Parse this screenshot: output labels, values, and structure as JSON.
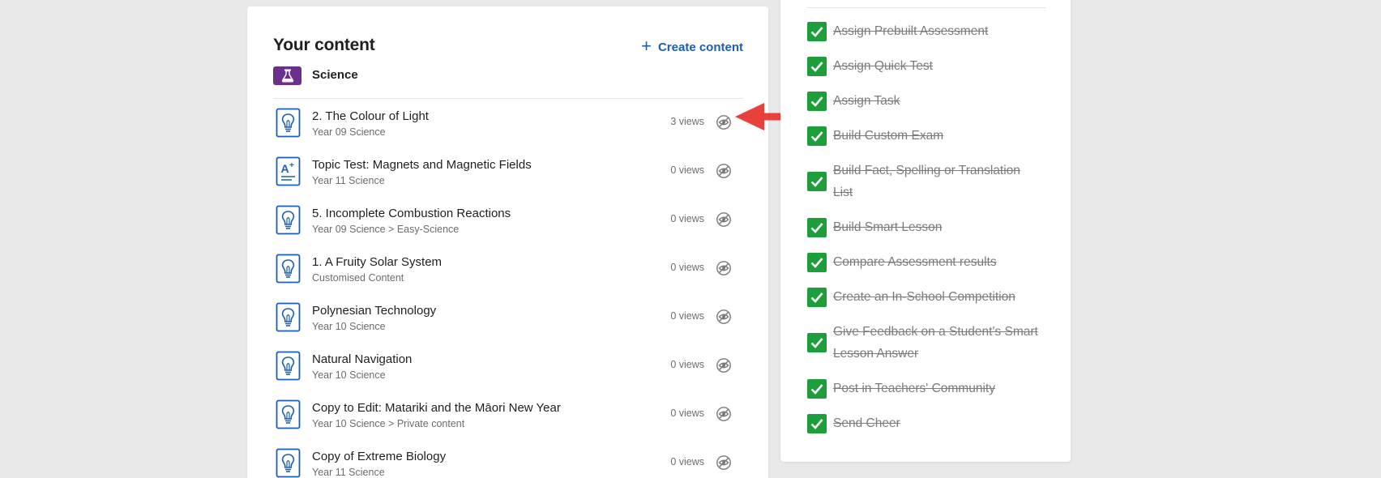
{
  "content_panel": {
    "title": "Your content",
    "create_label": "Create content",
    "subject": "Science",
    "items": [
      {
        "title": "2. The Colour of Light",
        "subtitle": "Year 09 Science",
        "views": "3 views",
        "icon": "lightbulb-icon"
      },
      {
        "title": "Topic Test: Magnets and Magnetic Fields",
        "subtitle": "Year 11 Science",
        "views": "0 views",
        "icon": "test-grade-icon"
      },
      {
        "title": "5. Incomplete Combustion Reactions",
        "subtitle": "Year 09 Science > Easy-Science",
        "views": "0 views",
        "icon": "lightbulb-icon"
      },
      {
        "title": "1. A Fruity Solar System",
        "subtitle": "Customised Content",
        "views": "0 views",
        "icon": "lightbulb-icon"
      },
      {
        "title": "Polynesian Technology",
        "subtitle": "Year 10 Science",
        "views": "0 views",
        "icon": "lightbulb-icon"
      },
      {
        "title": "Natural Navigation",
        "subtitle": "Year 10 Science",
        "views": "0 views",
        "icon": "lightbulb-icon"
      },
      {
        "title": "Copy to Edit: Matariki and the Māori New Year",
        "subtitle": "Year 10 Science > Private content",
        "views": "0 views",
        "icon": "lightbulb-icon"
      },
      {
        "title": "Copy of Extreme Biology",
        "subtitle": "Year 11 Science",
        "views": "0 views",
        "icon": "lightbulb-icon"
      }
    ]
  },
  "tasks_panel": {
    "tasks": [
      {
        "label": "Assign Prebuilt Assessment",
        "done": true
      },
      {
        "label": "Assign Quick Test",
        "done": true
      },
      {
        "label": "Assign Task",
        "done": true
      },
      {
        "label": "Build Custom Exam",
        "done": true
      },
      {
        "label": "Build Fact, Spelling or Translation List",
        "done": true
      },
      {
        "label": "Build Smart Lesson",
        "done": true
      },
      {
        "label": "Compare Assessment results",
        "done": true
      },
      {
        "label": "Create an In-School Competition",
        "done": true
      },
      {
        "label": "Give Feedback on a Student's Smart Lesson Answer",
        "done": true
      },
      {
        "label": "Post in Teachers' Community",
        "done": true
      },
      {
        "label": "Send Cheer",
        "done": true
      }
    ]
  },
  "colors": {
    "accent": "#1a5fb4",
    "subject": "#6b2f8c",
    "check": "#1e9e3a",
    "annotation_arrow": "#e8403a"
  }
}
